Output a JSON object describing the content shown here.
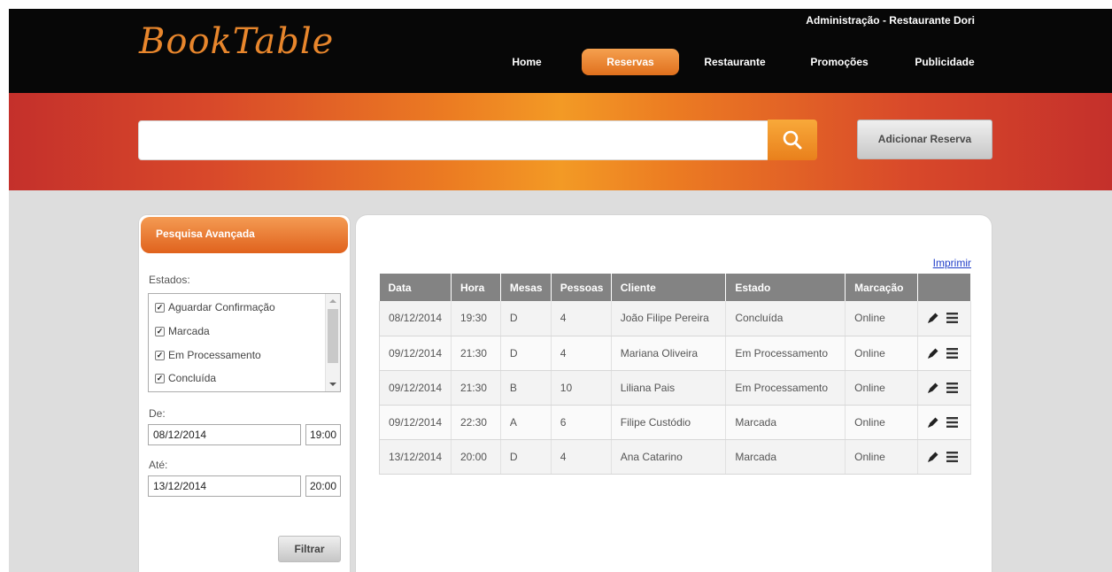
{
  "header": {
    "logo": "BookTable",
    "admin_label": "Administração - Restaurante Dori",
    "nav": [
      {
        "label": "Home",
        "active": false
      },
      {
        "label": "Reservas",
        "active": true
      },
      {
        "label": "Restaurante",
        "active": false
      },
      {
        "label": "Promoções",
        "active": false
      },
      {
        "label": "Publicidade",
        "active": false
      }
    ]
  },
  "search": {
    "value": "",
    "icon": "search-icon"
  },
  "actions": {
    "add_reservation": "Adicionar Reserva"
  },
  "sidebar": {
    "title": "Pesquisa Avançada",
    "estados_label": "Estados:",
    "estados": [
      {
        "label": "Aguardar Confirmação",
        "checked": true
      },
      {
        "label": "Marcada",
        "checked": true
      },
      {
        "label": "Em Processamento",
        "checked": true
      },
      {
        "label": "Concluída",
        "checked": true
      }
    ],
    "from_label": "De:",
    "from_date": "08/12/2014",
    "from_time": "19:00",
    "to_label": "Até:",
    "to_date": "13/12/2014",
    "to_time": "20:00",
    "filter_button": "Filtrar"
  },
  "main": {
    "print_link": "Imprimir",
    "table": {
      "headers": [
        "Data",
        "Hora",
        "Mesas",
        "Pessoas",
        "Cliente",
        "Estado",
        "Marcação",
        ""
      ],
      "rows": [
        [
          "08/12/2014",
          "19:30",
          "D",
          "4",
          "João Filipe Pereira",
          "Concluída",
          "Online"
        ],
        [
          "09/12/2014",
          "21:30",
          "D",
          "4",
          "Mariana Oliveira",
          "Em Processamento",
          "Online"
        ],
        [
          "09/12/2014",
          "21:30",
          "B",
          "10",
          "Liliana Pais",
          "Em Processamento",
          "Online"
        ],
        [
          "09/12/2014",
          "22:30",
          "A",
          "6",
          "Filipe Custódio",
          "Marcada",
          "Online"
        ],
        [
          "13/12/2014",
          "20:00",
          "D",
          "4",
          "Ana Catarino",
          "Marcada",
          "Online"
        ]
      ],
      "row_actions": [
        "pencil-icon",
        "menu-icon"
      ]
    }
  },
  "colors": {
    "accent": "#ec7c22",
    "header_bg": "#070707",
    "table_header": "#838383",
    "link": "#1e3cc8"
  }
}
